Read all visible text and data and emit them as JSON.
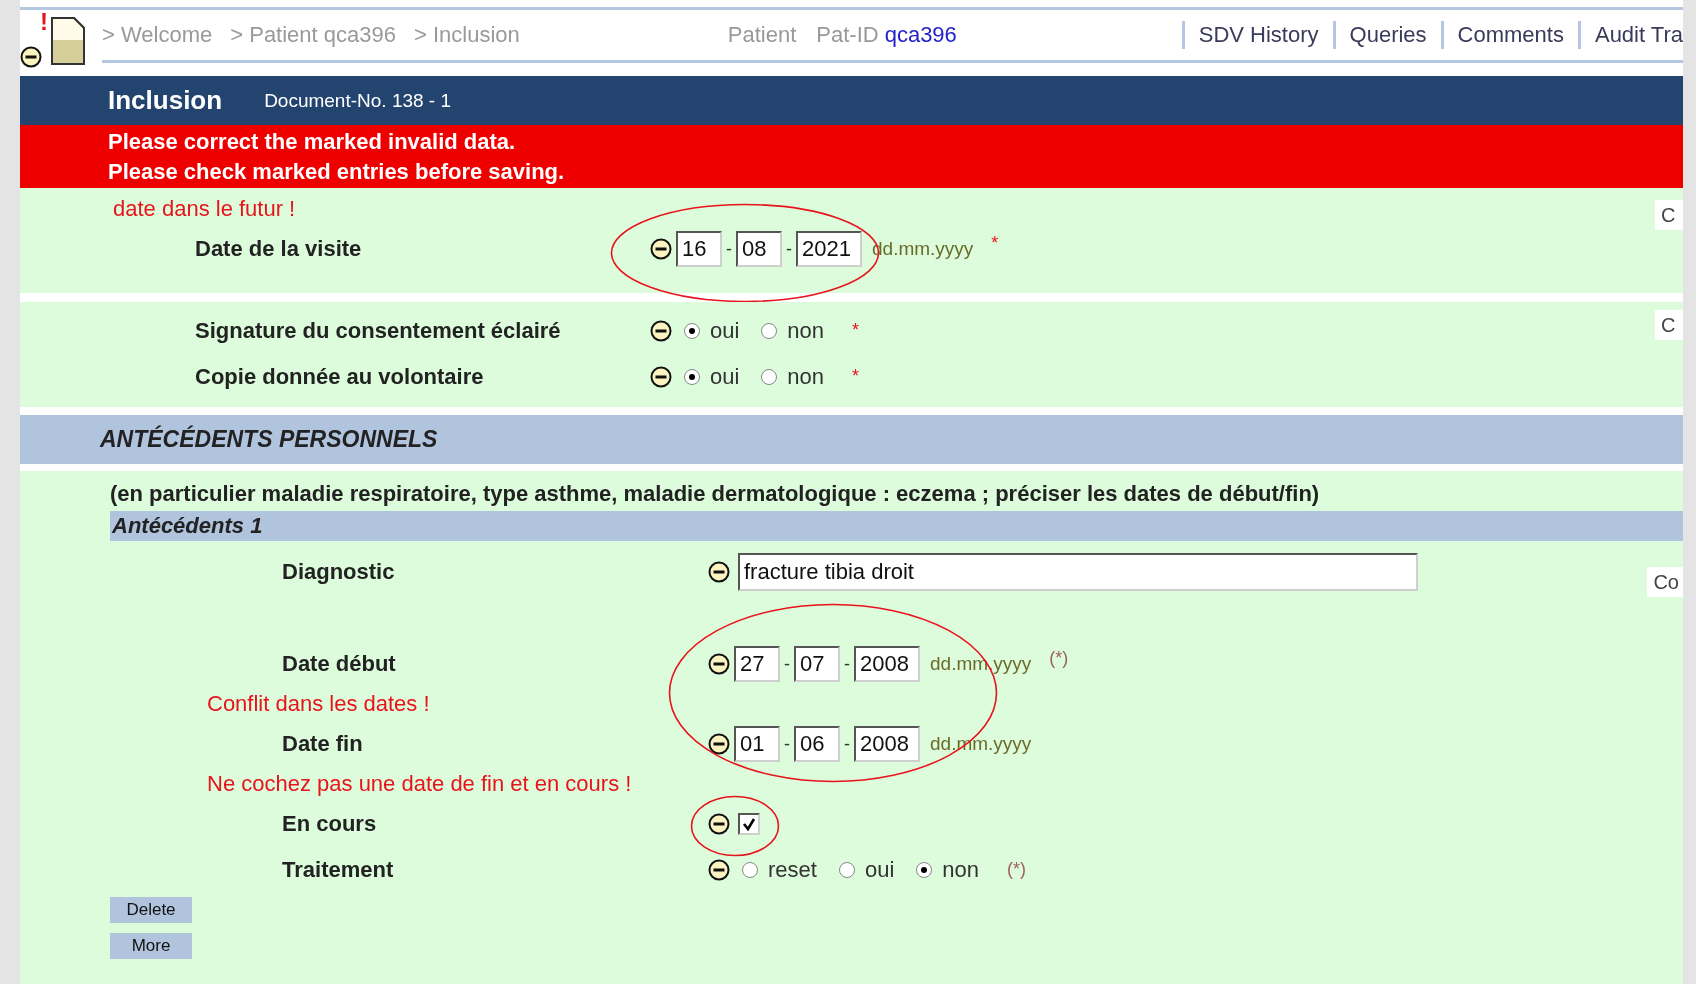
{
  "topbar": {
    "alert_mark": "!",
    "breadcrumbs": [
      "> Welcome",
      "> Patient qca396",
      "> Inclusion"
    ],
    "patient_label": "Patient",
    "patient_id_label": "Pat-ID",
    "patient_id": "qca396",
    "links": [
      "SDV History",
      "Queries",
      "Comments",
      "Audit Tra"
    ]
  },
  "document": {
    "title": "Inclusion",
    "number": "Document-No. 138 - 1"
  },
  "errors": [
    "Please correct the marked invalid data.",
    "Please check marked entries before saving."
  ],
  "blocks": [
    {
      "side_button": "C",
      "items": [
        {
          "kind": "message",
          "text": "date dans le futur !"
        },
        {
          "kind": "date",
          "label": "Date de la visite",
          "day": "16",
          "separator": "-",
          "month": "08",
          "year": "2021",
          "format": "dd.mm.yyyy",
          "required": "*",
          "circled": true
        }
      ]
    },
    {
      "side_button": "C",
      "items": [
        {
          "kind": "radio",
          "label": "Signature du consentement éclairé",
          "options": [
            {
              "label": "oui",
              "selected": true
            },
            {
              "label": "non",
              "selected": false
            }
          ],
          "required": "*"
        },
        {
          "kind": "radio",
          "label": "Copie donnée au volontaire",
          "options": [
            {
              "label": "oui",
              "selected": true
            },
            {
              "label": "non",
              "selected": false
            }
          ],
          "required": "*"
        }
      ]
    }
  ],
  "section": {
    "title": "ANTÉCÉDENTS PERSONNELS",
    "note": "(en particulier maladie respiratoire, type asthme, maladie dermatologique : eczema ; préciser les dates de début/fin)",
    "subsection": "Antécédents 1",
    "side_button": "Co",
    "items": [
      {
        "kind": "text",
        "label": "Diagnostic",
        "value": "fracture tibia droit"
      },
      {
        "kind": "group",
        "circled": true,
        "items": [
          {
            "kind": "date",
            "label": "Date début",
            "day": "27",
            "separator": "-",
            "month": "07",
            "year": "2008",
            "format": "dd.mm.yyyy",
            "required": "(*)"
          },
          {
            "kind": "message",
            "text": "Conflit dans les dates !"
          },
          {
            "kind": "date",
            "label": "Date fin",
            "day": "01",
            "separator": "-",
            "month": "06",
            "year": "2008",
            "format": "dd.mm.yyyy"
          }
        ]
      },
      {
        "kind": "message",
        "text": "Ne cochez pas une date de fin et en cours !"
      },
      {
        "kind": "checkbox",
        "label": "En cours",
        "checked": true,
        "circled": true
      },
      {
        "kind": "radio",
        "label": "Traitement",
        "options": [
          {
            "label": "reset",
            "selected": false
          },
          {
            "label": "oui",
            "selected": false
          },
          {
            "label": "non",
            "selected": true
          }
        ],
        "required": "(*)"
      }
    ],
    "buttons": [
      "Delete",
      "More"
    ]
  }
}
